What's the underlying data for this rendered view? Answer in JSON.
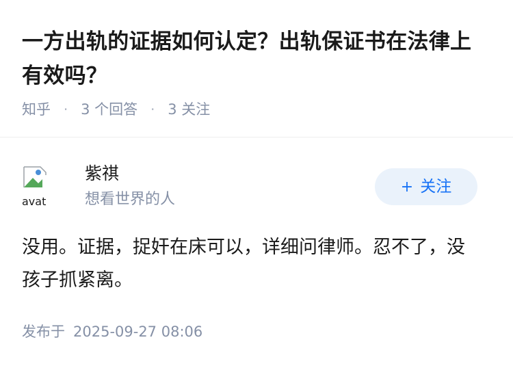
{
  "question": {
    "title": "一方出轨的证据如何认定？出轨保证书在法律上有效吗？",
    "source": "知乎",
    "answer_count": "3",
    "answer_unit": "个回答",
    "follow_count": "3",
    "follow_unit": "关注"
  },
  "answer": {
    "author": {
      "name": "紫祺",
      "bio": "想看世界的人",
      "avatar_alt": "avatar"
    },
    "follow_button": {
      "plus": "+",
      "label": "关注"
    },
    "content": "没用。证据，捉奸在床可以，详细问律师。忍不了，没孩子抓紧离。",
    "published_label": "发布于",
    "published_time": "2025-09-27 08:06"
  },
  "colors": {
    "title": "#1a1a1a",
    "meta": "#8590a6",
    "accent": "#1772f6",
    "follow_bg": "#eaf2fb"
  },
  "icons": {
    "avatar": "broken-image-icon"
  }
}
